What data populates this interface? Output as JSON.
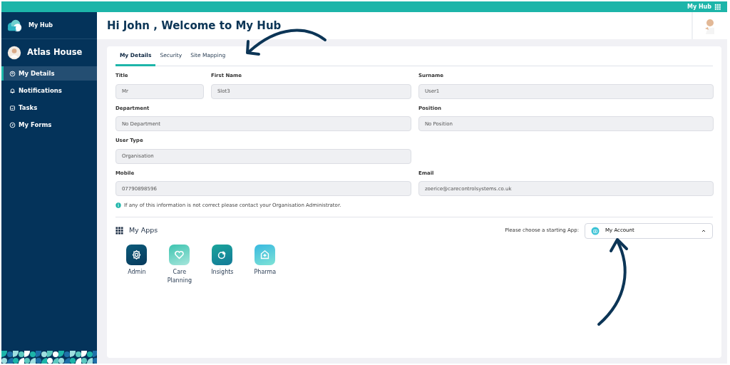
{
  "topbar": {
    "label": "My Hub"
  },
  "sidebar": {
    "brand": "My Hub",
    "site": "Atlas House",
    "items": [
      {
        "label": "My Details",
        "selected": true
      },
      {
        "label": "Notifications",
        "selected": false
      },
      {
        "label": "Tasks",
        "selected": false
      },
      {
        "label": "My Forms",
        "selected": false
      }
    ]
  },
  "header": {
    "title": "Hi John , Welcome to My Hub"
  },
  "tabs": [
    {
      "label": "My Details",
      "selected": true
    },
    {
      "label": "Security",
      "selected": false
    },
    {
      "label": "Site Mapping",
      "selected": false
    }
  ],
  "fields": [
    {
      "label": "Title",
      "value": "Mr"
    },
    {
      "label": "First Name",
      "value": "Slot3"
    },
    {
      "label": "Surname",
      "value": "User1"
    },
    {
      "label": "Department",
      "value": "No Department"
    },
    {
      "label": "Position",
      "value": "No Position"
    },
    {
      "label": "User Type",
      "value": "Organisation"
    },
    {
      "label": "Mobile",
      "value": "07790898596"
    },
    {
      "label": "Email",
      "value": "zoerice@carecontrolsystems.co.uk"
    }
  ],
  "note": "If any of this information is not correct please contact your Organisation Administrator.",
  "apps": {
    "title": "My Apps",
    "prompt": "Please choose a starting App:",
    "starting_app": "My Account",
    "items": [
      {
        "label": "Admin",
        "kind": "admin"
      },
      {
        "label": "Care Planning",
        "kind": "care"
      },
      {
        "label": "Insights",
        "kind": "insights"
      },
      {
        "label": "Pharma",
        "kind": "pharma"
      }
    ]
  }
}
